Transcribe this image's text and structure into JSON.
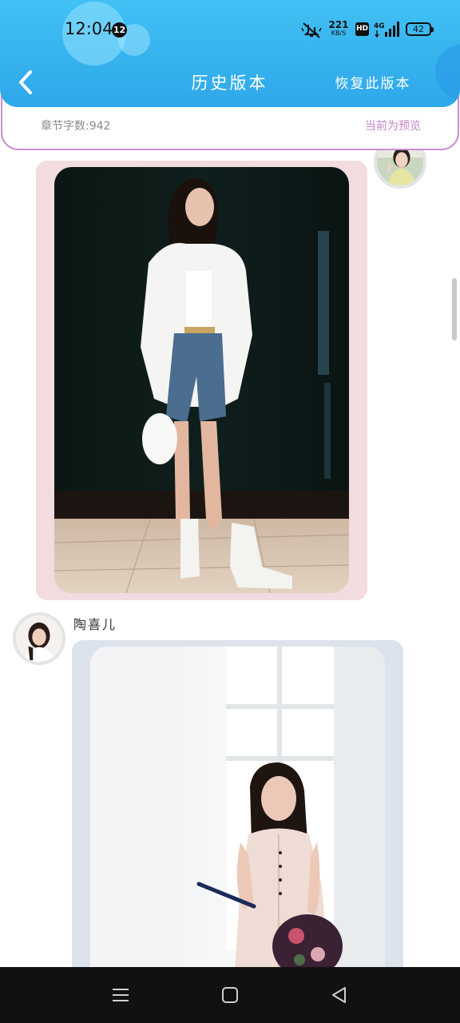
{
  "status_bar": {
    "time": "12:04",
    "notification_count": "12",
    "net_speed_value": "221",
    "net_speed_unit": "KB/S",
    "hd_label": "HD",
    "network_type": "4G",
    "battery_level": "42"
  },
  "nav": {
    "title": "历史版本",
    "restore_label": "恢复此版本",
    "back_icon": "chevron-left-icon"
  },
  "info": {
    "word_count": "章节字数:942",
    "preview_status": "当前为预览"
  },
  "messages": [
    {
      "side": "right",
      "type": "image",
      "image_description_icon": "photo"
    },
    {
      "side": "left",
      "sender": "陶喜儿",
      "type": "image",
      "image_description_icon": "photo"
    }
  ],
  "colors": {
    "header_blue": "#36b2ee",
    "info_border": "#c98fd0",
    "preview_text": "#c584c7",
    "card_pink": "#f2dcdf",
    "card_gray": "#dde3ec"
  },
  "system_nav": {
    "menu_icon": "menu-icon",
    "home_icon": "home-square-icon",
    "back_icon": "back-triangle-icon"
  }
}
